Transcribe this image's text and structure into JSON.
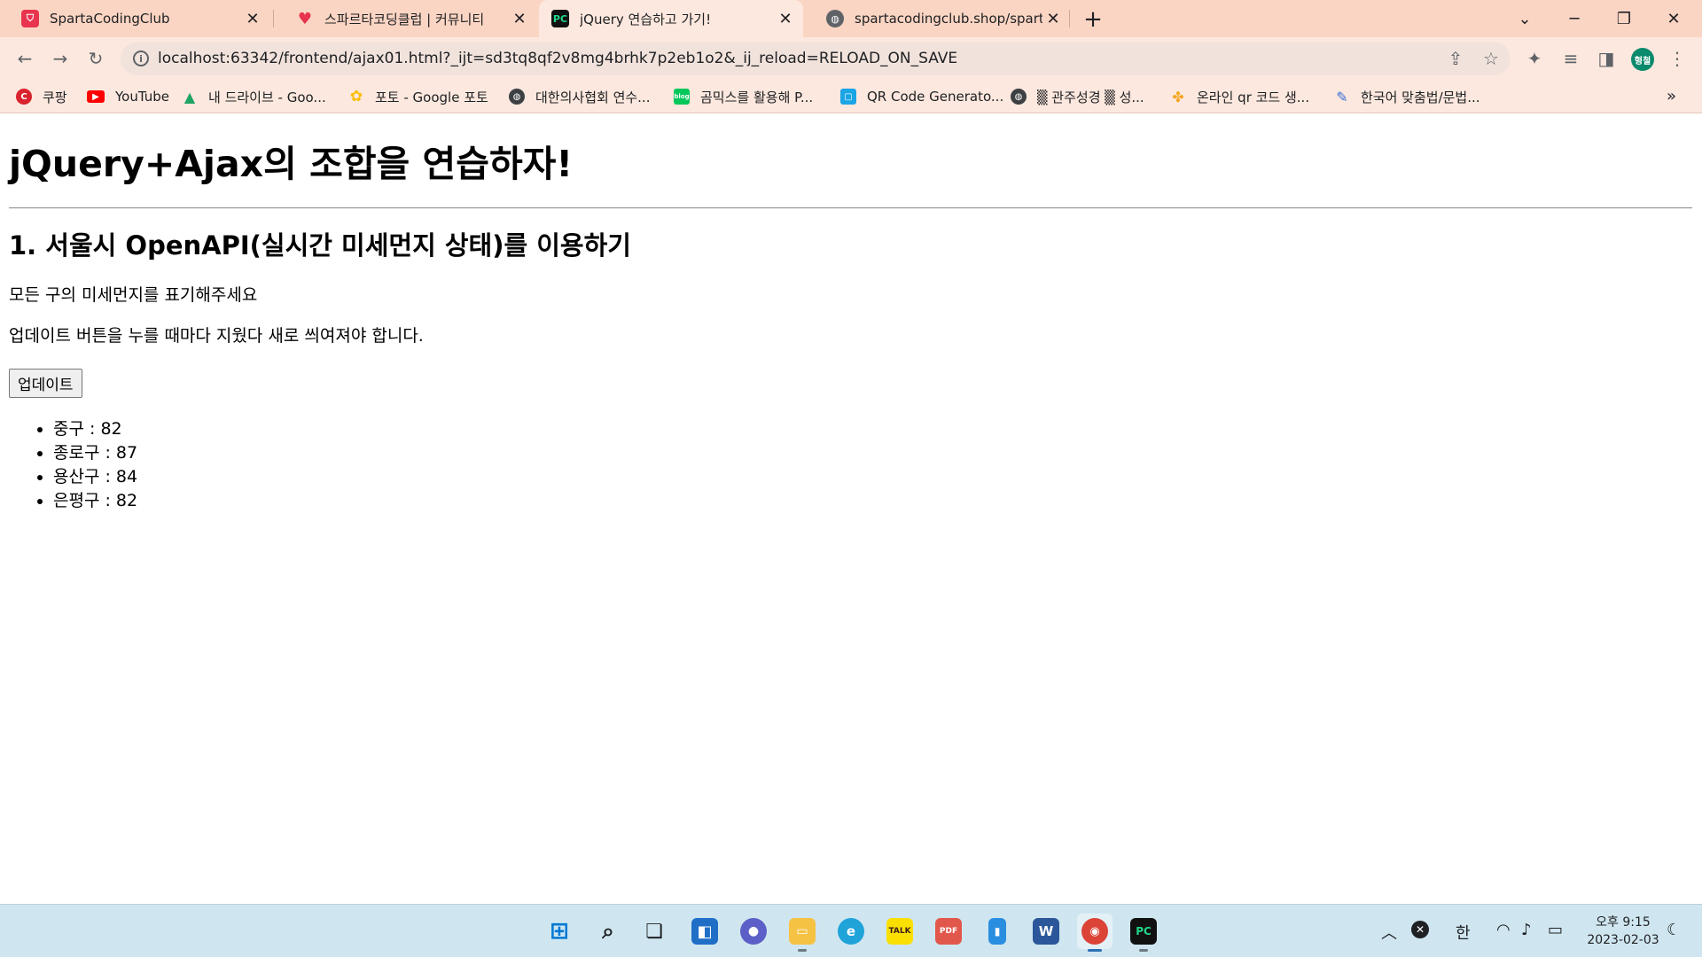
{
  "browser": {
    "tabs": [
      {
        "title": "SpartaCodingClub",
        "favicon": "sparta-logo-icon",
        "active": false
      },
      {
        "title": "스파르타코딩클럽 | 커뮤니티",
        "favicon": "heart-logo-icon",
        "active": false
      },
      {
        "title": "jQuery 연습하고 가기!",
        "favicon": "pycharm-icon",
        "active": true
      },
      {
        "title": "spartacodingclub.shop/sparta_a",
        "favicon": "globe-icon",
        "active": false
      }
    ],
    "address_bar": {
      "url": "localhost:63342/frontend/ajax01.html?_ijt=sd3tq8qf2v8mg4brhk7p2eb1o2&_ij_reload=RELOAD_ON_SAVE"
    },
    "profile_initials": "형철",
    "bookmarks": [
      {
        "label": "쿠팡",
        "icon": "coupang-icon"
      },
      {
        "label": "YouTube",
        "icon": "youtube-icon"
      },
      {
        "label": "내 드라이브 - Goo...",
        "icon": "google-drive-icon"
      },
      {
        "label": "포토 - Google 포토",
        "icon": "google-photos-icon"
      },
      {
        "label": "대한의사협회 연수...",
        "icon": "globe-icon"
      },
      {
        "label": "곰믹스를 활용해 P...",
        "icon": "blog-icon"
      },
      {
        "label": "QR Code Generato...",
        "icon": "qr-code-icon"
      },
      {
        "label": "▒ 관주성경 ▒ 성...",
        "icon": "globe-icon"
      },
      {
        "label": "온라인 qr 코드 생...",
        "icon": "flower-logo-icon"
      },
      {
        "label": "한국어 맞춤법/문법...",
        "icon": "spellcheck-icon"
      }
    ]
  },
  "page": {
    "heading": "jQuery+Ajax의 조합을 연습하자!",
    "subheading": "1. 서울시 OpenAPI(실시간 미세먼지 상태)를 이용하기",
    "paragraph1": "모든 구의 미세먼지를 표기해주세요",
    "paragraph2": "업데이트 버튼을 누를 때마다 지웠다 새로 씌여져야 합니다.",
    "button_label": "업데이트",
    "items": [
      {
        "text": "중구 : 82"
      },
      {
        "text": "종로구 : 87"
      },
      {
        "text": "용산구 : 84"
      },
      {
        "text": "은평구 : 82"
      }
    ]
  },
  "taskbar": {
    "ime": "한",
    "clock_time": "오후 9:15",
    "clock_date": "2023-02-03",
    "colors": {
      "tab_strip": "#fbd5c3",
      "toolbar": "#fce8de",
      "taskbar": "#cfe6f0",
      "accent": "#0078d4"
    }
  }
}
